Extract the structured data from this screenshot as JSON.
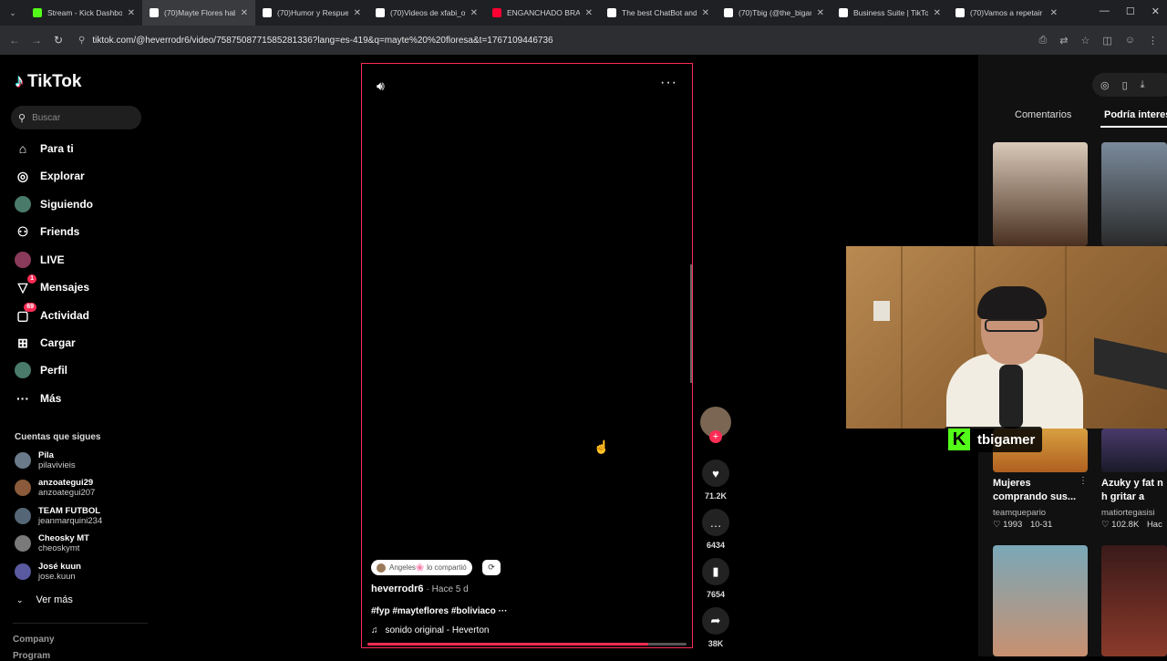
{
  "browser": {
    "tabs": [
      {
        "title": "Stream - Kick Dashbo",
        "icon": "kick-icon",
        "color": "#53fc18",
        "active": false
      },
      {
        "title": "(70)Mayte Flores hab",
        "icon": "tiktok-icon",
        "color": "#ffffff",
        "active": true
      },
      {
        "title": "(70)Humor y Respue",
        "icon": "tiktok-icon",
        "color": "#ffffff",
        "active": false
      },
      {
        "title": "(70)Videos de xfabi_o",
        "icon": "tiktok-icon",
        "color": "#ffffff",
        "active": false
      },
      {
        "title": "ENGANCHADO BRAS",
        "icon": "youtube-icon",
        "color": "#ff0033",
        "active": false
      },
      {
        "title": "The best ChatBot and",
        "icon": "chatbot-icon",
        "color": "#ffffff",
        "active": false
      },
      {
        "title": "(70)Tbig (@the_bigan",
        "icon": "tiktok-icon",
        "color": "#ffffff",
        "active": false
      },
      {
        "title": "Business Suite | TikTo",
        "icon": "tiktok-icon",
        "color": "#ffffff",
        "active": false
      },
      {
        "title": "(70)Vamos a repetair",
        "icon": "tiktok-icon",
        "color": "#ffffff",
        "active": false
      }
    ],
    "url": "tiktok.com/@heverrodr6/video/7587508771585281336?lang=es-419&q=mayte%20%20floresa&t=1767109446736"
  },
  "sidebar": {
    "logo": "TikTok",
    "search_placeholder": "Buscar",
    "nav": [
      {
        "label": "Para ti",
        "icon": "home-icon",
        "glyph": "⌂",
        "badge": ""
      },
      {
        "label": "Explorar",
        "icon": "compass-icon",
        "glyph": "◎",
        "badge": ""
      },
      {
        "label": "Siguiendo",
        "icon": "following-avatar-icon",
        "glyph": "●",
        "badge": ""
      },
      {
        "label": "Friends",
        "icon": "friends-icon",
        "glyph": "⚇",
        "badge": ""
      },
      {
        "label": "LIVE",
        "icon": "live-icon",
        "glyph": "●",
        "badge": ""
      },
      {
        "label": "Mensajes",
        "icon": "messages-icon",
        "glyph": "▽",
        "badge": "1"
      },
      {
        "label": "Actividad",
        "icon": "activity-icon",
        "glyph": "▢",
        "badge": "69"
      },
      {
        "label": "Cargar",
        "icon": "upload-icon",
        "glyph": "⊞",
        "badge": ""
      },
      {
        "label": "Perfil",
        "icon": "profile-avatar-icon",
        "glyph": "●",
        "badge": ""
      },
      {
        "label": "Más",
        "icon": "more-icon",
        "glyph": "···",
        "badge": ""
      }
    ],
    "following_title": "Cuentas que sigues",
    "following": [
      {
        "name": "Pila",
        "handle": "pilavivieis",
        "color": "#6b7a8a"
      },
      {
        "name": "anzoategui29",
        "handle": "anzoategui207",
        "color": "#8a5a3a"
      },
      {
        "name": "TEAM FUTBOL",
        "handle": "jeanmarquini234",
        "color": "#556677"
      },
      {
        "name": "Cheosky MT",
        "handle": "cheoskymt",
        "color": "#7a7a7a"
      },
      {
        "name": "José kuun",
        "handle": "jose.kuun",
        "color": "#5a5aa0"
      }
    ],
    "see_more": "Ver más",
    "company": "Company",
    "program": "Program"
  },
  "video": {
    "shared_by": "Angeles🌸 lo compartió",
    "author": "heverrodr6",
    "time": "· Hace 5 d",
    "description": "#fyp #mayteflores #boliviaco ···",
    "sound": "sonido original - Heverton",
    "progress": 0.88,
    "likes": "71.2K",
    "comments": "6434",
    "saves": "7654",
    "shares": "38K"
  },
  "right_panel": {
    "tab_comments": "Comentarios",
    "tab_interest": "Podría interesarte",
    "items": [
      {
        "title": "Mujeres comprando sus...",
        "author": "teamquepario",
        "likes": "1993",
        "date": "10-31"
      },
      {
        "title": "Azuky y fat n h gritar a todo C",
        "author": "matiortegasisi",
        "likes": "102.8K",
        "date": "Hac"
      }
    ]
  },
  "overlay": {
    "channel": "tbigamer",
    "brand_color": "#53fc18"
  }
}
